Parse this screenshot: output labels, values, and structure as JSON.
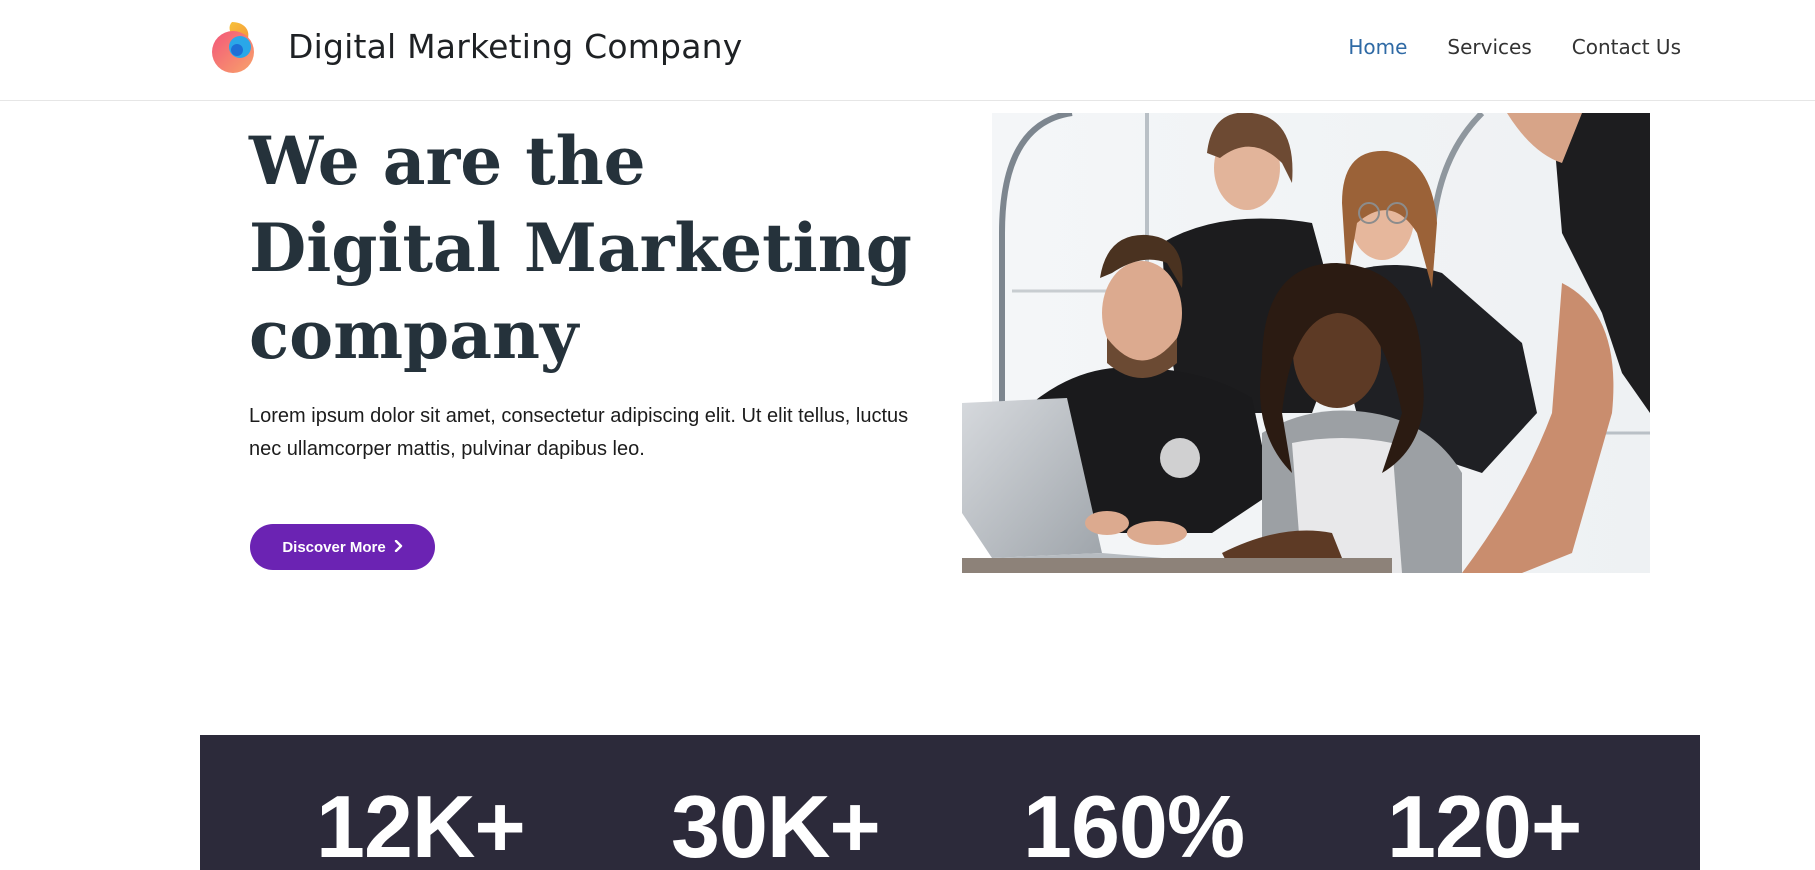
{
  "header": {
    "brand": "Digital Marketing Company",
    "nav": [
      {
        "label": "Home",
        "active": true
      },
      {
        "label": "Services",
        "active": false
      },
      {
        "label": "Contact Us",
        "active": false
      }
    ]
  },
  "hero": {
    "title_lines": [
      "We are the",
      "Digital Marketing",
      "company"
    ],
    "text": "Lorem ipsum dolor sit amet, consectetur adipiscing elit. Ut elit tellus, luctus nec ullamcorper mattis, pulvinar dapibus leo.",
    "cta_label": "Discover More",
    "cta_icon": "chevron-right-icon",
    "image": "team-working-at-laptop-photo"
  },
  "stats": [
    {
      "value": "12K+"
    },
    {
      "value": "30K+"
    },
    {
      "value": "160%"
    },
    {
      "value": "120+"
    }
  ],
  "colors": {
    "accent": "#6b23b3",
    "nav_active": "#2f6aa5",
    "heading": "#25323b",
    "stats_bg": "#2c2a3a"
  }
}
